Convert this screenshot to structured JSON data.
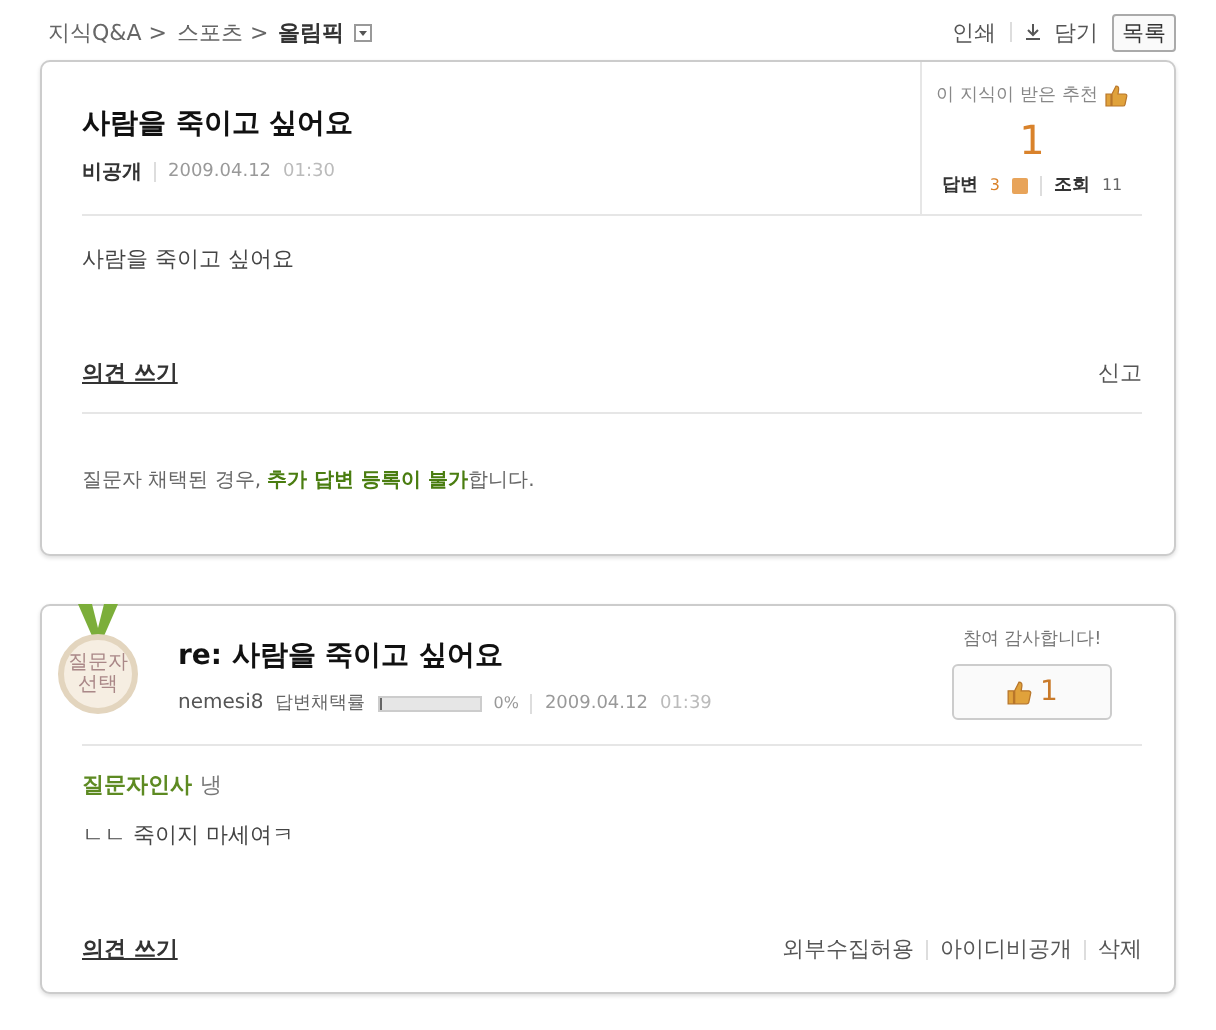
{
  "breadcrumb": {
    "items": [
      "지식Q&A >",
      "스포츠 >"
    ],
    "current": "올림픽"
  },
  "tools": {
    "print": "인쇄",
    "save": "담기",
    "list_button": "목록"
  },
  "question": {
    "title": "사람을 죽이고 싶어요",
    "author": "비공개",
    "date": "2009.04.12",
    "time": "01:30",
    "recommend_label": "이 지식이 받은 추천",
    "recommend_count": "1",
    "answers_label": "답변",
    "answers_count": "3",
    "views_label": "조회",
    "views_count": "11",
    "body": "사람을 죽이고 싶어요",
    "comment_link": "의견 쓰기",
    "report": "신고",
    "notice": "질문자 채택된 경우, **추가 답변 등록이 불가**합니다."
  },
  "answer": {
    "badge_lines": [
      "질문자",
      "선택"
    ],
    "title": "re: 사람을 죽이고 싶어요",
    "author": "nemesi8",
    "adoption_label": "답변채택률",
    "level": 0.03,
    "adoption_reading": "0%",
    "date": "2009.04.12",
    "time": "01:39",
    "thanks_label": "참여 감사합니다!",
    "like_count": "1",
    "greeting_label": "질문자인사",
    "greeting": "냉",
    "body": "ㄴㄴ 죽이지 마세여ㅋ",
    "comment_link": "의견 쓰기",
    "actions": [
      "외부수집허용",
      "아이디비공개",
      "삭제"
    ]
  }
}
